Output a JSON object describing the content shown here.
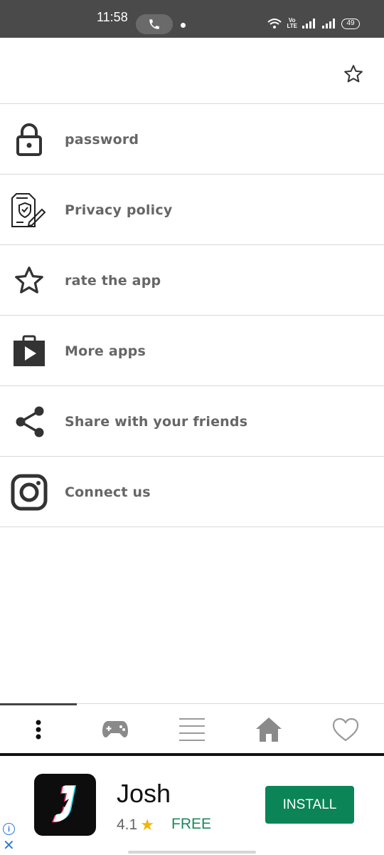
{
  "status_bar": {
    "time": "11:58",
    "network_label": "Vo\nLTE",
    "battery": "49"
  },
  "app_bar": {
    "favorite_icon": "star-outline-icon"
  },
  "menu": {
    "items": [
      {
        "label": "password",
        "icon": "lock-icon"
      },
      {
        "label": "Privacy policy",
        "icon": "privacy-document-icon"
      },
      {
        "label": "rate the app",
        "icon": "star-outline-icon"
      },
      {
        "label": "More apps",
        "icon": "play-store-bag-icon"
      },
      {
        "label": "Share with your friends",
        "icon": "share-icon"
      },
      {
        "label": "Connect us",
        "icon": "instagram-icon"
      }
    ]
  },
  "bottom_nav": {
    "items": [
      {
        "icon": "more-vertical-icon",
        "active": true
      },
      {
        "icon": "gamepad-icon"
      },
      {
        "icon": "list-icon"
      },
      {
        "icon": "home-icon"
      },
      {
        "icon": "heart-icon"
      }
    ]
  },
  "ad": {
    "app_name": "Josh",
    "rating": "4.1",
    "price": "FREE",
    "install_label": "INSTALL",
    "info_label": "i",
    "close_label": "✕",
    "colors": {
      "install": "#0b8457",
      "star": "#f4b400",
      "free": "#1a8a5a"
    }
  }
}
